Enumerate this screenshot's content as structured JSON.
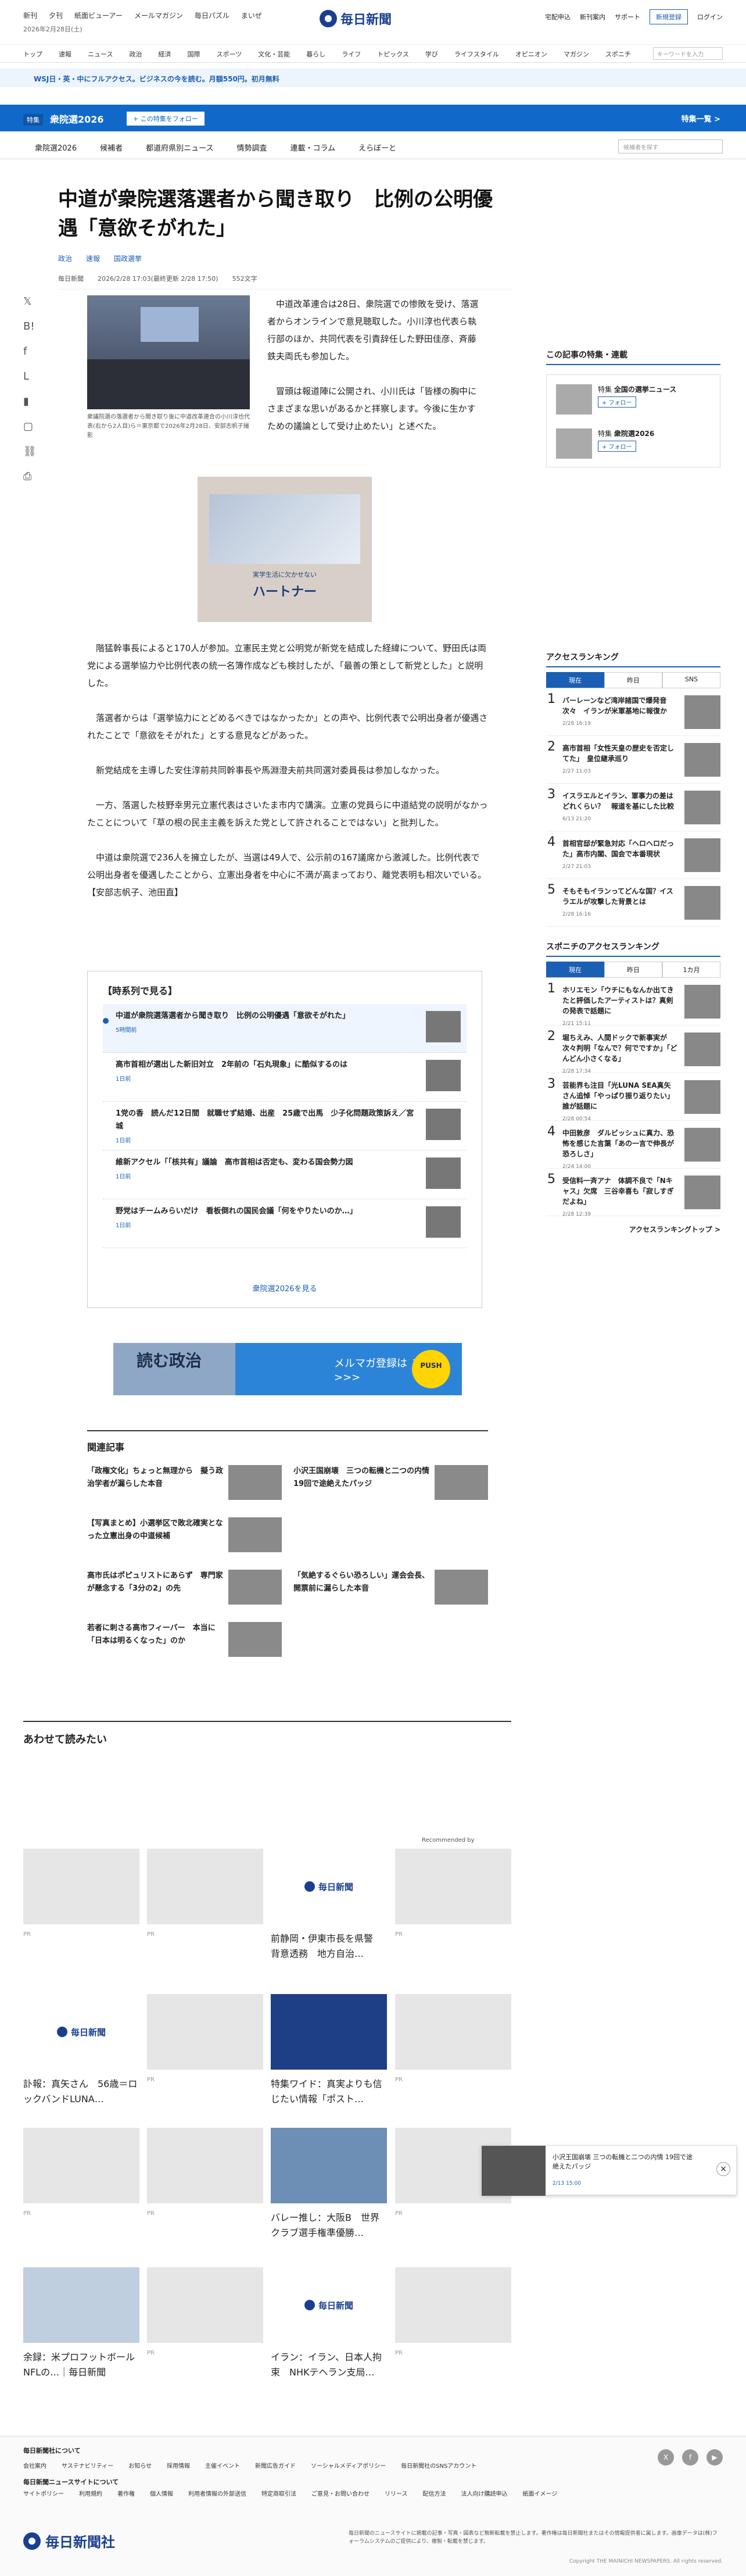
{
  "header": {
    "nav": [
      "新刊",
      "夕刊",
      "紙面ビューアー",
      "メールマガジン",
      "毎日パズル",
      "まいぜ"
    ],
    "date": "2026年2月28日(土)",
    "logo": "毎日新聞",
    "right": [
      "宅配申込",
      "新刊案内",
      "サポート"
    ],
    "signup": "新規登録",
    "login": "ログイン"
  },
  "gnav": {
    "items": [
      "トップ",
      "速報",
      "ニュース",
      "政治",
      "経済",
      "国際",
      "スポーツ",
      "文化・芸能",
      "暮らし",
      "ライフ",
      "トピックス",
      "学び",
      "ライフスタイル",
      "オピニオン",
      "マガジン",
      "スポニチ"
    ],
    "search_placeholder": "キーワードを入力"
  },
  "promo": "WSJ日・英・中にフルアクセス。ビジネスの今を読む。月額550円。初月無料",
  "feature": {
    "badge": "特集",
    "name": "衆院選2026",
    "follow": "+ この特集をフォロー",
    "list": "特集一覧 >"
  },
  "subnav": {
    "items": [
      "衆院選2026",
      "候補者",
      "都道府県別ニュース",
      "情勢調査",
      "連載・コラム",
      "えらぼーと"
    ],
    "search_placeholder": "候補者を探す"
  },
  "article": {
    "title": "中道が衆院選落選者から聞き取り　比例の公明優遇「意欲そがれた」",
    "tags": [
      "政治",
      "速報",
      "国政選挙"
    ],
    "meta": [
      "毎日新聞",
      "2026/2/28 17:03(最終更新 2/28 17:50)",
      "552文字"
    ],
    "caption": "衆議院選の落選者から聞き取り後に中道改革連合の小川淳也代表(右から2人目)ら＝東京都で2026年2月28日、安部志帆子撮影",
    "lead": [
      "中道改革連合は28日、衆院選での惨敗を受け、落選者からオンラインで意見聴取した。小川淳也代表ら執行部のほか、共同代表を引責辞任した野田佳彦、斉藤鉄夫両氏も参加した。",
      "冒頭は報道陣に公開され、小川氏は「皆様の胸中にさまざまな思いがあるかと拝察します。今後に生かすための議論として受け止めたい」と述べた。"
    ],
    "ad_title": "ハートナー",
    "ad_sub": "実学生活に欠かせない",
    "body": [
      "階猛幹事長によると170人が参加。立憲民主党と公明党が新党を結成した経緯について、野田氏は両党による選挙協力や比例代表の統一名簿作成なども検討したが、「最善の策として新党とした」と説明した。",
      "落選者からは「選挙協力にとどめるべきではなかったか」との声や、比例代表で公明出身者が優遇されたことで「意欲をそがれた」とする意見などがあった。",
      "新党結成を主導した安住淳前共同幹事長や馬淵澄夫前共同選対委員長は参加しなかった。",
      "一方、落選した枝野幸男元立憲代表はさいたま市内で講演。立憲の党員らに中道結党の説明がなかったことについて「草の根の民主主義を訴えた党として許されることではない」と批判した。",
      "中道は衆院選で236人を擁立したが、当選は49人で、公示前の167議席から激減した。比例代表で公明出身者を優遇したことから、立憲出身者を中心に不満が高まっており、離党表明も相次いでいる。【安部志帆子、池田直】"
    ]
  },
  "timeline": {
    "heading": "【時系列で見る】",
    "items": [
      {
        "title": "中道が衆院選落選者から聞き取り　比例の公明優遇「意欲そがれた」",
        "time": "5時間前"
      },
      {
        "title": "高市首相が選出した新旧対立　2年前の「石丸現象」に酷似するのは",
        "time": "1日前"
      },
      {
        "title": "1党の香　読んだ12日間　就職せず結婚、出産　25歳で出馬　少子化問題政策訴え／宮城",
        "time": "1日前"
      },
      {
        "title": "維新アクセル「「核共有」議論　高市首相は否定も、変わる国会勢力図",
        "time": "1日前"
      },
      {
        "title": "野党はチームみらいだけ　看板倒れの国民会議「何をやりたいのか…」",
        "time": "1日前"
      }
    ],
    "more": "衆院選2026を見る"
  },
  "ad2": {
    "left": "読む政治",
    "mid": "メルマガ登録は\nこちら >>>",
    "push": "PUSH"
  },
  "related": {
    "heading": "関連記事",
    "items": [
      "「政権文化」ちょっと無理から　擬う政治学者が漏らした本音",
      "小沢王国崩壊　三つの転機と二つの内情　19回で途絶えたパッジ",
      "【写真まとめ】小選挙区で敗北確実となった立憲出身の中道候補",
      "",
      "高市氏はポピュリストにあらず　専門家が懸念する「3分の2」の先",
      "「気絶するぐらい恐ろしい」運会会長、開票前に漏らした本音",
      "若者に刺さる高市フィーバー　本当に「日本は明るくなった」のか"
    ]
  },
  "awase": {
    "heading": "あわせて読みたい",
    "recommended": "Recommended by",
    "cards": [
      {
        "text": "",
        "pr": "PR"
      },
      {
        "text": "",
        "pr": "PR"
      },
      {
        "text": "前静岡・伊東市長を県警　背意透務　地方自治…",
        "pr": ""
      },
      {
        "text": "",
        "pr": "PR"
      },
      {
        "text": "訃報：真矢さん　56歳＝ロックバンドLUNA…",
        "pr": ""
      },
      {
        "text": "",
        "pr": "PR"
      },
      {
        "text": "特集ワイド：真実よりも信じたい情報「ポスト…",
        "pr": ""
      },
      {
        "text": "",
        "pr": "PR"
      },
      {
        "text": "",
        "pr": "PR"
      },
      {
        "text": "",
        "pr": "PR"
      },
      {
        "text": "バレー推し：大阪B　世界クラブ選手権準優勝…",
        "pr": ""
      },
      {
        "text": "",
        "pr": "PR"
      },
      {
        "text": "余録：米プロフットボールNFLの…｜毎日新聞",
        "pr": ""
      },
      {
        "text": "",
        "pr": "PR"
      },
      {
        "text": "イラン：イラン、日本人拘束　NHKテヘラン支局…",
        "pr": ""
      },
      {
        "text": "",
        "pr": "PR"
      }
    ]
  },
  "sidebar": {
    "feat_heading": "この記事の特集・連載",
    "feats": [
      {
        "label": "特集",
        "name": "全国の選挙ニュース",
        "follow": "+ フォロー"
      },
      {
        "label": "特集",
        "name": "衆院選2026",
        "follow": "+ フォロー"
      }
    ],
    "rank_heading": "アクセスランキング",
    "rank_tabs": [
      "現在",
      "昨日",
      "SNS"
    ],
    "ranks": [
      {
        "t": "バーレーンなど湾岸諸国で爆発音次々　イランが米軍基地に報復か",
        "d": "2/28 16:19"
      },
      {
        "t": "高市首相「女性天皇の歴史を否定してた」　皇位継承巡り",
        "d": "2/27 11:03"
      },
      {
        "t": "イスラエルとイラン、軍事力の差はどれくらい？　報道を基にした比較",
        "d": "6/13 21:20"
      },
      {
        "t": "首相官邸が緊急対応「ヘロヘロだった」高市内閣、国会で本番現状",
        "d": "2/27 21:03"
      },
      {
        "t": "そもそもイランってどんな国？イスラエルが攻撃した背景とは",
        "d": "2/28 16:16"
      }
    ],
    "sp_heading": "スポニチのアクセスランキング",
    "sp_tabs": [
      "現在",
      "昨日",
      "1カ月"
    ],
    "sp": [
      {
        "t": "ホリエモン「ウチにもなんか出てきたと評価したアーティストは？真剣の発表で話題に",
        "d": "2/21 15:11"
      },
      {
        "t": "堀ちえみ、人間ドックで新事実が次々判明「なんで？何でですか」「どんどん小さくなる」",
        "d": "2/28 17:34"
      },
      {
        "t": "芸能界も注目「光LUNA SEA真矢さん追悼「やっぱり振り返りたい」　誰が話題に",
        "d": "2/28 00:54"
      },
      {
        "t": "中田敦彦　ダルビッシュに真力、恐怖を感じた言葉「あの一言で伸長が恐ろしさ」",
        "d": "2/24 14:00"
      },
      {
        "t": "受信料一斉アナ　体調不良で「Nキャス」欠席　三谷幸喜も「寂しすぎだよね」",
        "d": "2/28 12:39"
      }
    ],
    "rank_more": "アクセスランキングトップ >"
  },
  "float": {
    "title": "小沢王国崩壊 三つの転機と二つの内情 19回で途絶えたパッジ",
    "date": "2/13 15:00"
  },
  "footer": {
    "h1": "毎日新聞社について",
    "links1": [
      "会社案内",
      "サステナビリティー",
      "お知らせ",
      "採用情報",
      "主催イベント",
      "新聞広告ガイド",
      "ソーシャルメディアポリシー",
      "毎日新聞社のSNSアカウント"
    ],
    "h2": "毎日新聞ニュースサイトについて",
    "links2": [
      "サイトポリシー",
      "利用規約",
      "著作権",
      "個人情報",
      "利用者情報の外部送信",
      "特定商取引法",
      "ご意見・お問い合わせ",
      "リリース",
      "配信方法",
      "法人向け購読申込",
      "紙面イメージ"
    ],
    "logo": "毎日新聞社",
    "note": "毎日新聞のニュースサイトに掲載の記事・写真・図表など無断転載を禁止します。著作権は毎日新聞社またはその情報提供者に属します。画像データは(株)フォーラムシステムのご提供により、複製・転載を禁じます。",
    "copy": "Copyright THE MAINICHI NEWSPAPERS. All rights reserved."
  }
}
